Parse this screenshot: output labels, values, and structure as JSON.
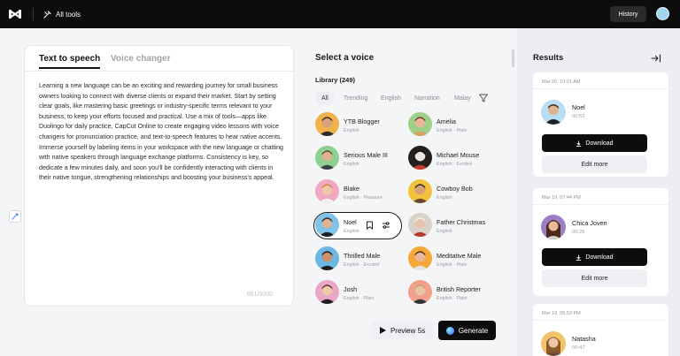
{
  "topbar": {
    "all_tools_label": "All tools",
    "history_label": "History"
  },
  "editor": {
    "tabs": [
      {
        "label": "Text to speech"
      },
      {
        "label": "Voice changer"
      }
    ],
    "text": "Learning a new language can be an exciting and rewarding journey for small business owners looking to connect with diverse clients or expand their market. Start by setting clear goals, like mastering basic greetings or industry-specific terms relevant to your business, to keep your efforts focused and practical. Use a mix of tools—apps like Duolingo for daily practice, CapCut Online to create engaging video lessons with voice changers for pronunciation practice, and text-to-speech features to hear native accents. Immerse yourself by labeling items in your workspace with the new language or chatting with native speakers through language exchange platforms. Consistency is key, so dedicate a few minutes daily, and soon you'll be confidently interacting with clients in their native tongue, strengthening relationships and boosting your business's appeal.",
    "char_count": "861/5000"
  },
  "voices": {
    "title": "Select a voice",
    "library_label": "Library (249)",
    "filters": [
      "All",
      "Trending",
      "English",
      "Narration",
      "Malay"
    ],
    "items": [
      {
        "name": "YTB Blogger",
        "meta": "English"
      },
      {
        "name": "Amelia",
        "meta": "English · Plain"
      },
      {
        "name": "Serious Male III",
        "meta": "English"
      },
      {
        "name": "Michael Mouse",
        "meta": "English · Excited"
      },
      {
        "name": "Blake",
        "meta": "English · Pleasure"
      },
      {
        "name": "Cowboy Bob",
        "meta": "English"
      },
      {
        "name": "Noel",
        "meta": "English"
      },
      {
        "name": "Father Christmas",
        "meta": "English"
      },
      {
        "name": "Thrilled Male",
        "meta": "English · Excited"
      },
      {
        "name": "Meditative Male",
        "meta": "English · Plain"
      },
      {
        "name": "Josh",
        "meta": "English · Plain"
      },
      {
        "name": "British Reporter",
        "meta": "English · Plain"
      }
    ],
    "preview_label": "Preview 5s",
    "generate_label": "Generate"
  },
  "results": {
    "title": "Results",
    "items": [
      {
        "date": "Mar 20, 10:01 AM",
        "name": "Noel",
        "duration": "00:53",
        "download_label": "Download",
        "edit_label": "Edit more"
      },
      {
        "date": "Mar 19, 07:44 PM",
        "name": "Chica Joven",
        "duration": "00:25",
        "download_label": "Download",
        "edit_label": "Edit more"
      },
      {
        "date": "Mar 19, 05:53 PM",
        "name": "Natasha",
        "duration": "00:47"
      }
    ]
  },
  "colors": {
    "topbar": "#0d0d0d",
    "accent_button": "#0d0d0d",
    "panel": "#edeef1"
  }
}
